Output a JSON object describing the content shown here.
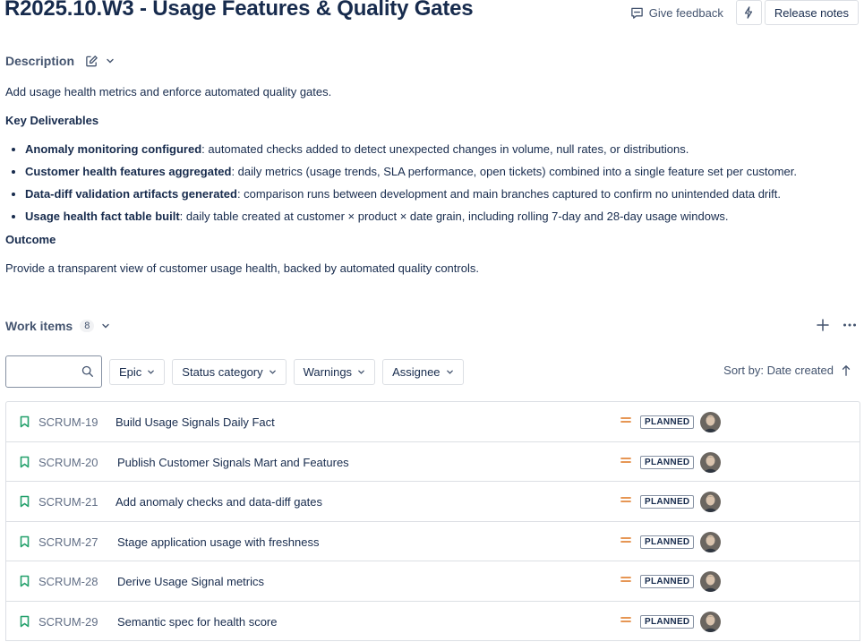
{
  "page": {
    "title": "R2025.10.W3 - Usage Features & Quality Gates",
    "give_feedback": "Give feedback",
    "release_notes": "Release notes"
  },
  "description": {
    "label": "Description",
    "intro": "Add usage health metrics and enforce automated quality gates.",
    "deliverables_heading": "Key Deliverables",
    "deliverables": [
      {
        "bold": "Anomaly monitoring configured",
        "text": ": automated checks added to detect unexpected changes in volume, null rates, or distributions."
      },
      {
        "bold": "Customer health features aggregated",
        "text": ": daily metrics (usage trends, SLA performance, open tickets) combined into a single feature set per customer."
      },
      {
        "bold": "Data-diff validation artifacts generated",
        "text": ": comparison runs between development and main branches captured to confirm no unintended data drift."
      },
      {
        "bold": "Usage health fact table built",
        "text": ": daily table created at customer × product × date grain, including rolling 7-day and 28-day usage windows."
      }
    ],
    "outcome_heading": "Outcome",
    "outcome": "Provide a transparent view of customer usage health, backed by automated quality controls."
  },
  "work_items": {
    "label": "Work items",
    "count": "8",
    "search_placeholder": "",
    "filters": [
      "Epic",
      "Status category",
      "Warnings",
      "Assignee"
    ],
    "sort_label": "Sort by: Date created",
    "items": [
      {
        "key": "SCRUM-19",
        "summary": "Build Usage Signals Daily Fact",
        "status": "PLANNED"
      },
      {
        "key": "SCRUM-20",
        "summary": "Publish Customer Signals Mart and Features",
        "status": "PLANNED"
      },
      {
        "key": "SCRUM-21",
        "summary": "Add anomaly checks and data-diff gates",
        "status": "PLANNED"
      },
      {
        "key": "SCRUM-27",
        "summary": "Stage application usage with freshness",
        "status": "PLANNED"
      },
      {
        "key": "SCRUM-28",
        "summary": "Derive Usage Signal metrics",
        "status": "PLANNED"
      },
      {
        "key": "SCRUM-29",
        "summary": "Semantic spec for health score",
        "status": "PLANNED"
      }
    ]
  },
  "colors": {
    "story_icon": "#22a06b",
    "priority_medium": "#e2883c",
    "text": "#172b4d",
    "subtle": "#44546f"
  },
  "icons": {
    "feedback": "feedback-icon",
    "automation": "lightning-icon",
    "edit": "edit-icon",
    "chevron": "chevron-down-icon",
    "add": "plus-icon",
    "more": "more-icon",
    "search": "search-icon",
    "sort": "arrow-up-icon",
    "work_item": "bookmark-icon",
    "priority": "priority-medium-icon"
  }
}
